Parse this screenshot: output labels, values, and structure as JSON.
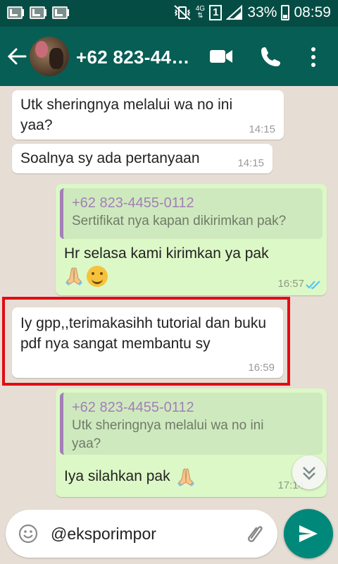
{
  "status_bar": {
    "network": "4G",
    "sim": "1",
    "battery": "33%",
    "time": "08:59"
  },
  "header": {
    "contact_name": "+62 823-44…"
  },
  "messages": [
    {
      "direction": "in",
      "text": "Utk sheringnya melalui wa no ini yaa?",
      "time": "14:15"
    },
    {
      "direction": "in",
      "text": "Soalnya sy ada pertanyaan",
      "time": "14:15"
    },
    {
      "direction": "out",
      "quote_from": "+62 823-4455-0112",
      "quote_text": "Sertifikat nya kapan dikirimkan pak?",
      "text": "Hr selasa kami kirimkan ya pak",
      "time": "16:57",
      "status": "read"
    },
    {
      "direction": "in",
      "text": "Iy gpp,,terimakasihh tutorial dan buku pdf nya sangat membantu sy",
      "time": "16:59"
    },
    {
      "direction": "out",
      "quote_from": "+62 823-4455-0112",
      "quote_text": "Utk sheringnya melalui wa no ini yaa?",
      "text": "Iya silahkan pak",
      "time": "17:14"
    }
  ],
  "composer": {
    "value": "@eksporimpor"
  },
  "colors": {
    "header": "#075e54",
    "status_bar": "#054d44",
    "outgoing_bubble": "#dcf8c6",
    "incoming_bubble": "#ffffff",
    "quote_accent": "#a27fb8",
    "highlight": "#e30b14",
    "send_button": "#00897b",
    "read_ticks": "#4fc3f7"
  }
}
